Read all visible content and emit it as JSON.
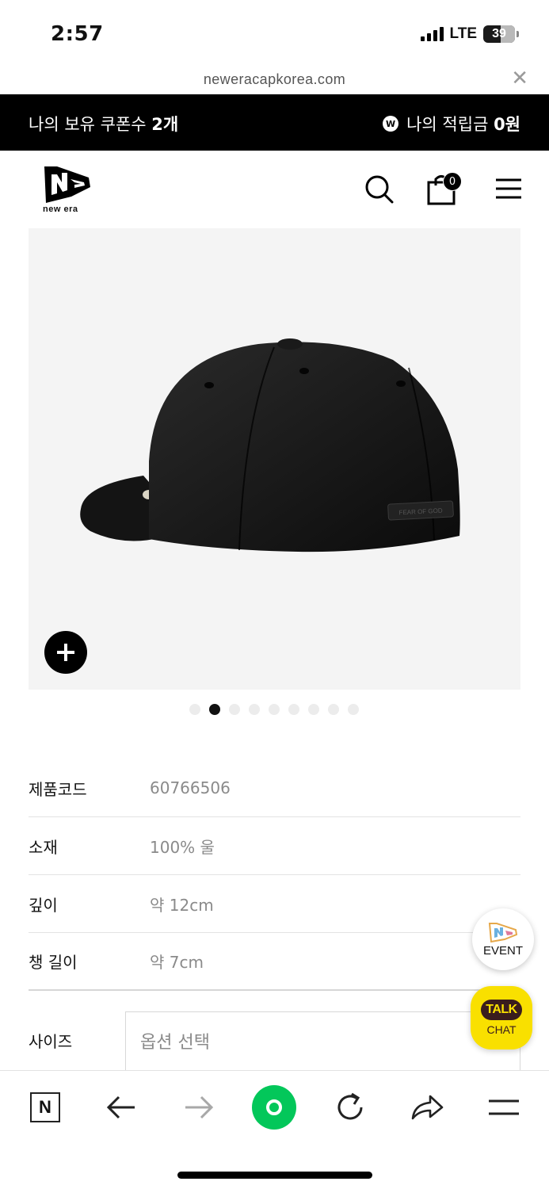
{
  "status_bar": {
    "time": "2:57",
    "network": "LTE",
    "battery": "39",
    "battery_level_percent": 39,
    "icons": [
      "signal-icon",
      "battery-icon"
    ]
  },
  "browser": {
    "url": "neweracapkorea.com",
    "close_icon": "close-icon"
  },
  "coupon_bar": {
    "coupon_prefix": "나의 보유 쿠폰수 ",
    "coupon_count": "2개",
    "badge": "W",
    "points_prefix": "나의 적립금 ",
    "points_value": "0원"
  },
  "header": {
    "logo_text": "new era",
    "cart_count": "0",
    "icons": [
      "search-icon",
      "shopping-bag-icon",
      "menu-icon"
    ]
  },
  "product_image": {
    "patch_text": "FEAR OF GOD",
    "slide_count": 9,
    "active_slide": 2
  },
  "specs": [
    {
      "label": "제품코드",
      "value": "60766506"
    },
    {
      "label": "소재",
      "value": "100% 울"
    },
    {
      "label": "깊이",
      "value": "약 12cm"
    },
    {
      "label": "챙 길이",
      "value": "약 7cm"
    }
  ],
  "size_option": {
    "label": "사이즈",
    "placeholder": "옵션 선택"
  },
  "floating": {
    "event_label": "EVENT",
    "talk_label": "TALK",
    "chat_label": "CHAT"
  },
  "toolbar": {
    "home_badge": "N",
    "icons": [
      "naver-home-icon",
      "back-arrow-icon",
      "forward-arrow-icon",
      "green-dot-icon",
      "refresh-icon",
      "share-icon",
      "menu-icon"
    ]
  },
  "colors": {
    "coupon_bar_bg": "#000000",
    "talk_yellow": "#f9e000",
    "green_dot": "#03c75a",
    "image_bg": "#f4f4f4"
  }
}
